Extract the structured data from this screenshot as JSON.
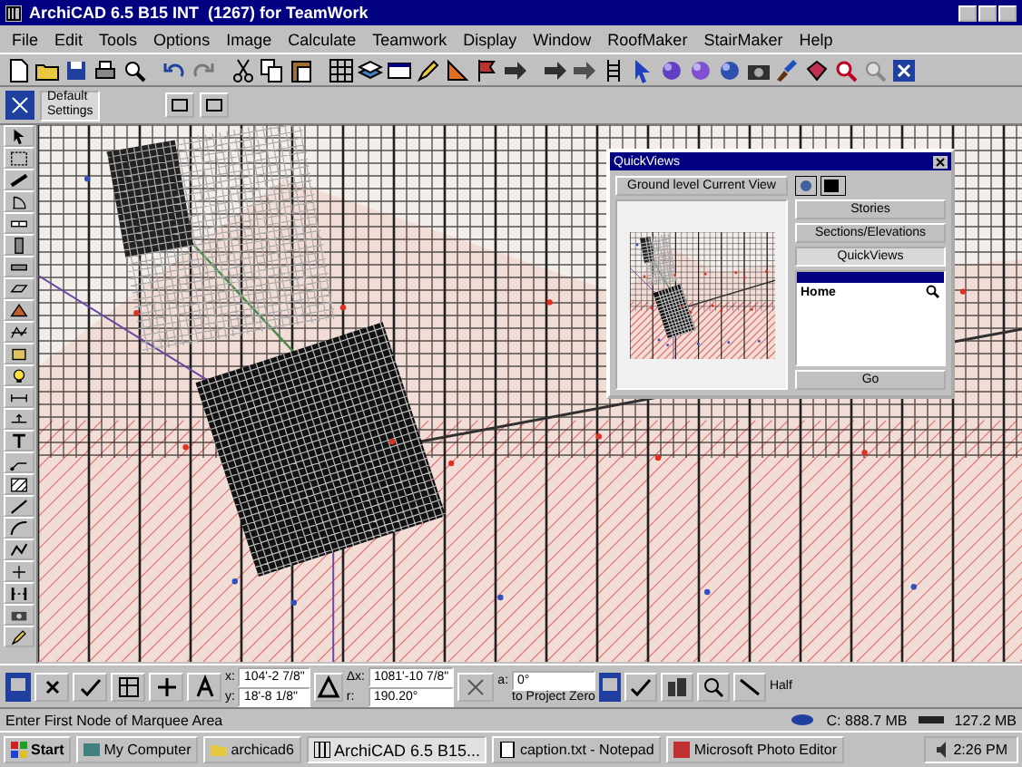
{
  "window": {
    "title": "ArchiCAD 6.5 B15 INT  (1267) for TeamWork"
  },
  "menu": [
    "File",
    "Edit",
    "Tools",
    "Options",
    "Image",
    "Calculate",
    "Teamwork",
    "Display",
    "Window",
    "RoofMaker",
    "StairMaker",
    "Help"
  ],
  "info_box": {
    "lines": [
      "Default",
      "Settings"
    ]
  },
  "quickviews_palette": {
    "title": "QuickViews",
    "preview_label": "Ground level Current View",
    "buttons": [
      {
        "label": "Stories",
        "selected": false
      },
      {
        "label": "Sections/Elevations",
        "selected": false
      },
      {
        "label": "QuickViews",
        "selected": true
      }
    ],
    "list_items": [
      {
        "label": "Home"
      }
    ],
    "go_button": "Go"
  },
  "coordinates": {
    "x_label": "x:",
    "x": "104'-2 7/8\"",
    "y_label": "y:",
    "y": "18'-8 1/8\"",
    "dx_label": "Δx:",
    "dx": "1081'-10 7/8\"",
    "r_label": "r:",
    "r": "190.20°",
    "angle_label": "a:",
    "angle": "0°",
    "reference": "to Project Zero",
    "pen": "Half"
  },
  "status_bar": {
    "prompt": "Enter First Node of Marquee Area",
    "disk": "C: 888.7 MB",
    "memory": "127.2 MB"
  },
  "taskbar": {
    "start": "Start",
    "tasks": [
      {
        "label": "My Computer",
        "selected": false
      },
      {
        "label": "archicad6",
        "selected": false
      },
      {
        "label": "ArchiCAD 6.5 B15...",
        "selected": true
      },
      {
        "label": "caption.txt - Notepad",
        "selected": false
      },
      {
        "label": "Microsoft Photo Editor",
        "selected": false
      }
    ],
    "clock": "2:26 PM"
  }
}
